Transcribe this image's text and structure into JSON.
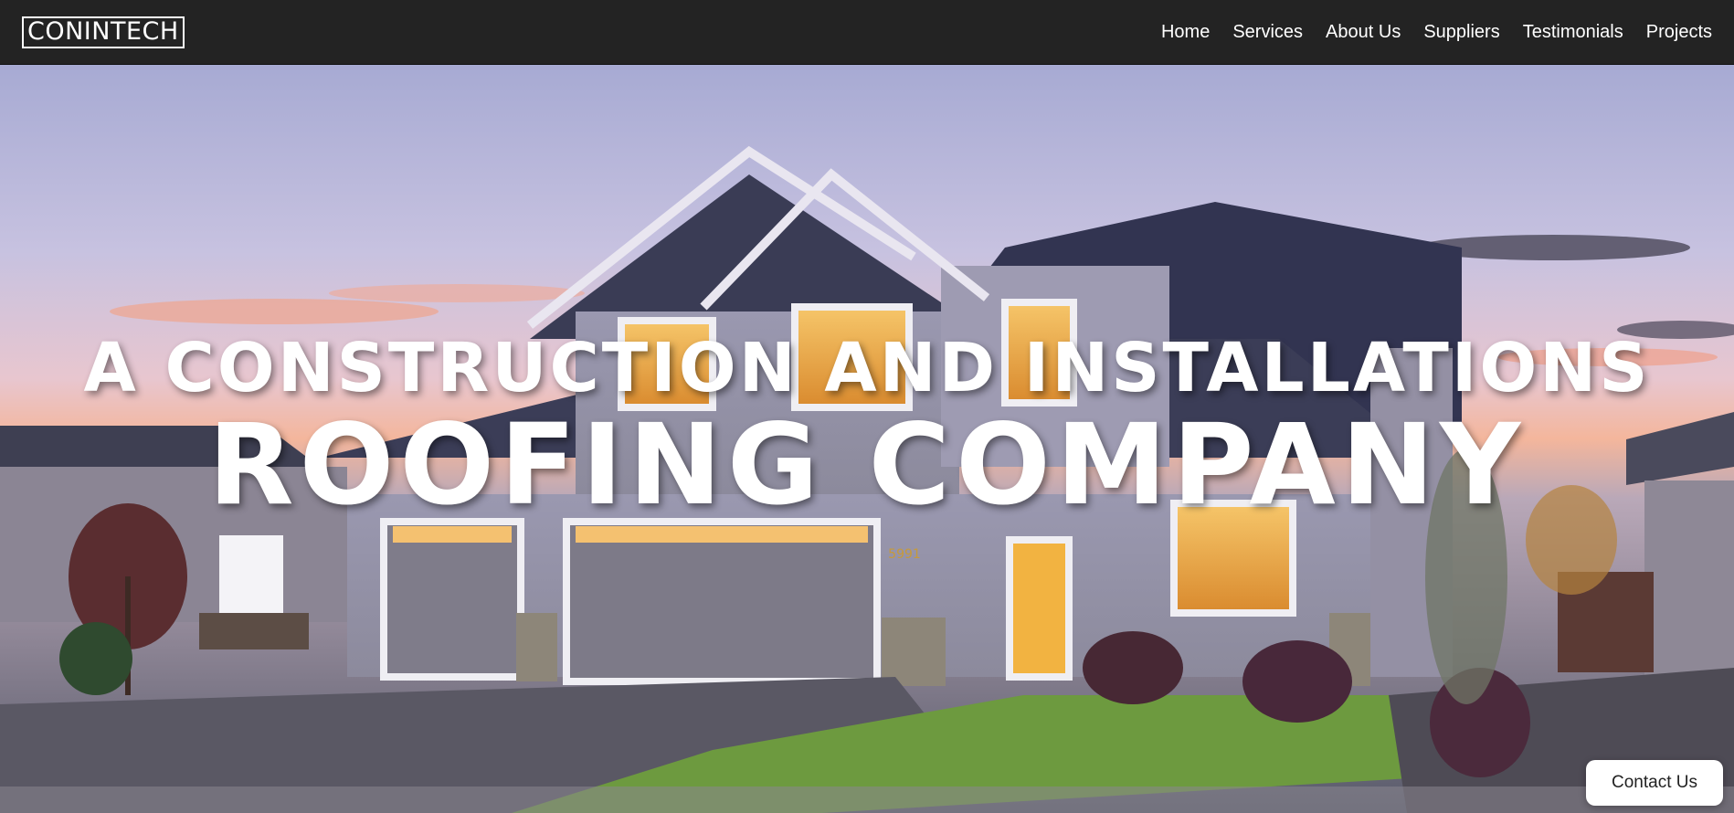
{
  "brand": {
    "logo_text": "CONINTECH"
  },
  "nav": {
    "items": [
      {
        "label": "Home"
      },
      {
        "label": "Services"
      },
      {
        "label": "About Us"
      },
      {
        "label": "Suppliers"
      },
      {
        "label": "Testimonials"
      },
      {
        "label": "Projects"
      }
    ]
  },
  "hero": {
    "headline_line1": "A CONSTRUCTION AND INSTALLATIONS",
    "headline_line2": "ROOFING COMPANY",
    "house_number": "5991",
    "background_image": "house-at-dusk"
  },
  "contact": {
    "button_label": "Contact Us"
  },
  "colors": {
    "navbar_bg": "#232323",
    "nav_text": "#ffffff",
    "headline_text": "#ffffff",
    "button_bg": "#ffffff"
  }
}
